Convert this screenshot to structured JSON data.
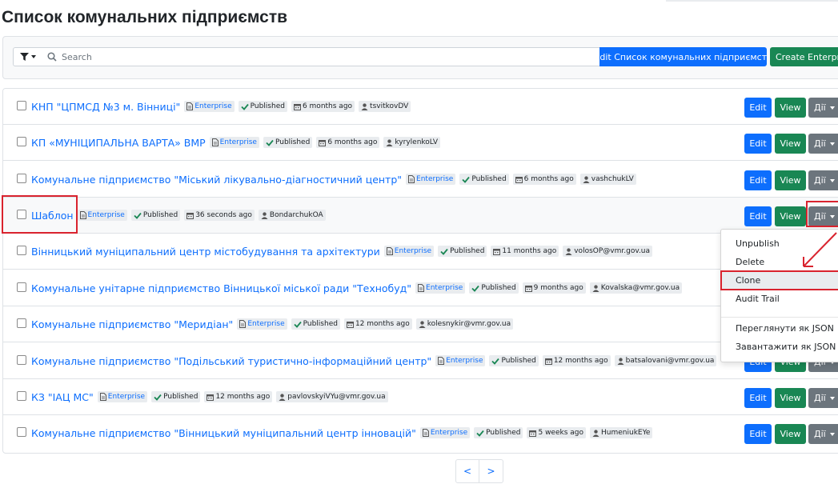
{
  "page": {
    "title": "Список комунальних підприємств"
  },
  "toolbar": {
    "search_placeholder": "Search",
    "edit_list_label": "Edit Список комунальних підприємств",
    "create_label": "Create Enterprise"
  },
  "row_actions": {
    "edit": "Edit",
    "view": "View",
    "actions": "Дії"
  },
  "items": [
    {
      "name": "КНП \"ЦПМСД №3 м. Вінниці\"",
      "type": "Enterprise",
      "status": "Published",
      "age": "6 months ago",
      "user": "tsvitkovDV"
    },
    {
      "name": "КП «МУНІЦИПАЛЬНА ВАРТА» ВМР",
      "type": "Enterprise",
      "status": "Published",
      "age": "6 months ago",
      "user": "kyrylenkoLV"
    },
    {
      "name": "Комунальне підприємство \"Міський лікувально-діагностичний центр\"",
      "type": "Enterprise",
      "status": "Published",
      "age": "6 months ago",
      "user": "vashchukLV"
    },
    {
      "name": "Шаблон",
      "type": "Enterprise",
      "status": "Published",
      "age": "36 seconds ago",
      "user": "BondarchukOA"
    },
    {
      "name": "Вінницький муніципальний центр містобудування та архітектури",
      "type": "Enterprise",
      "status": "Published",
      "age": "11 months ago",
      "user": "volosOP@vmr.gov.ua"
    },
    {
      "name": "Комунальне унітарне підприємство Вінницької міської ради \"Технобуд\"",
      "type": "Enterprise",
      "status": "Published",
      "age": "9 months ago",
      "user": "Kovalska@vmr.gov.ua"
    },
    {
      "name": "Комунальне підприємство \"Меридіан\"",
      "type": "Enterprise",
      "status": "Published",
      "age": "12 months ago",
      "user": "kolesnykir@vmr.gov.ua"
    },
    {
      "name": "Комунальне підприємство \"Подільський туристично-інформаційний центр\"",
      "type": "Enterprise",
      "status": "Published",
      "age": "12 months ago",
      "user": "batsalovani@vmr.gov.ua"
    },
    {
      "name": "КЗ \"ІАЦ МС\"",
      "type": "Enterprise",
      "status": "Published",
      "age": "12 months ago",
      "user": "pavlovskyiVYu@vmr.gov.ua"
    },
    {
      "name": "Комунальне підприємство \"Вінницький муніципальний центр інновацій\"",
      "type": "Enterprise",
      "status": "Published",
      "age": "5 weeks ago",
      "user": "HumeniukEYe"
    }
  ],
  "dropdown": {
    "items": [
      "Unpublish",
      "Delete",
      "Clone",
      "Audit Trail",
      "Переглянути як JSON",
      "Завантажити як JSON"
    ],
    "active": "Clone"
  },
  "pagination": {
    "prev": "<",
    "next": ">"
  },
  "colors": {
    "primary": "#0d6efd",
    "success": "#198754",
    "secondary": "#6c757d",
    "annotation": "#d9232e"
  }
}
